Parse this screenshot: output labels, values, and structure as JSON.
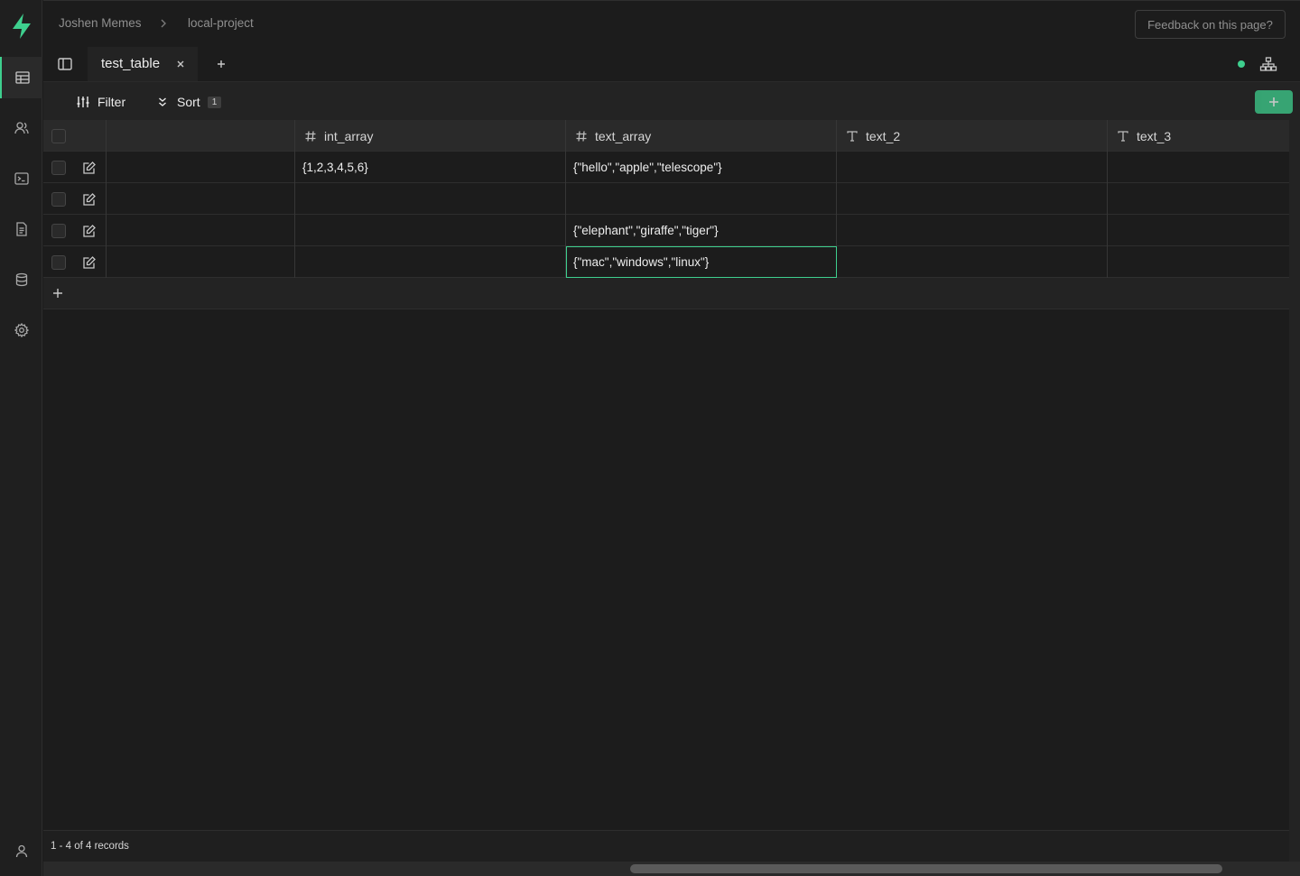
{
  "header": {
    "breadcrumb": [
      {
        "label": "Joshen Memes"
      },
      {
        "label": "local-project"
      }
    ],
    "feedback_label": "Feedback on this page?"
  },
  "rail": {
    "items": [
      {
        "icon": "table-editor-icon",
        "active": true
      },
      {
        "icon": "users-icon",
        "active": false
      },
      {
        "icon": "sql-terminal-icon",
        "active": false
      },
      {
        "icon": "document-icon",
        "active": false
      },
      {
        "icon": "database-icon",
        "active": false
      },
      {
        "icon": "gear-icon",
        "active": false
      }
    ],
    "bottom_icon": "user-icon",
    "accent": "#3ecf8e"
  },
  "tabs": [
    {
      "label": "test_table",
      "close": "×"
    }
  ],
  "toolbar": {
    "filter_label": "Filter",
    "sort_label": "Sort",
    "sort_count": "1",
    "insert_icon": "plus-icon"
  },
  "grid": {
    "columns": [
      {
        "name": "",
        "type_icon": ""
      },
      {
        "name": "int_array",
        "type_icon": "hash-icon"
      },
      {
        "name": "text_array",
        "type_icon": "hash-icon"
      },
      {
        "name": "text_2",
        "type_icon": "text-type-icon"
      },
      {
        "name": "text_3",
        "type_icon": "text-type-icon"
      }
    ],
    "rows": [
      [
        "",
        "{1,2,3,4,5,6}",
        "{\"hello\",\"apple\",\"telescope\"}",
        "",
        ""
      ],
      [
        "",
        "",
        "",
        "",
        ""
      ],
      [
        "",
        "",
        "{\"elephant\",\"giraffe\",\"tiger\"}",
        "",
        ""
      ],
      [
        "",
        "",
        "{\"mac\",\"windows\",\"linux\"}",
        "",
        ""
      ]
    ],
    "selected_cell": {
      "row": 3,
      "col": 2
    }
  },
  "footer": {
    "records_text": "1 - 4 of 4 records"
  }
}
